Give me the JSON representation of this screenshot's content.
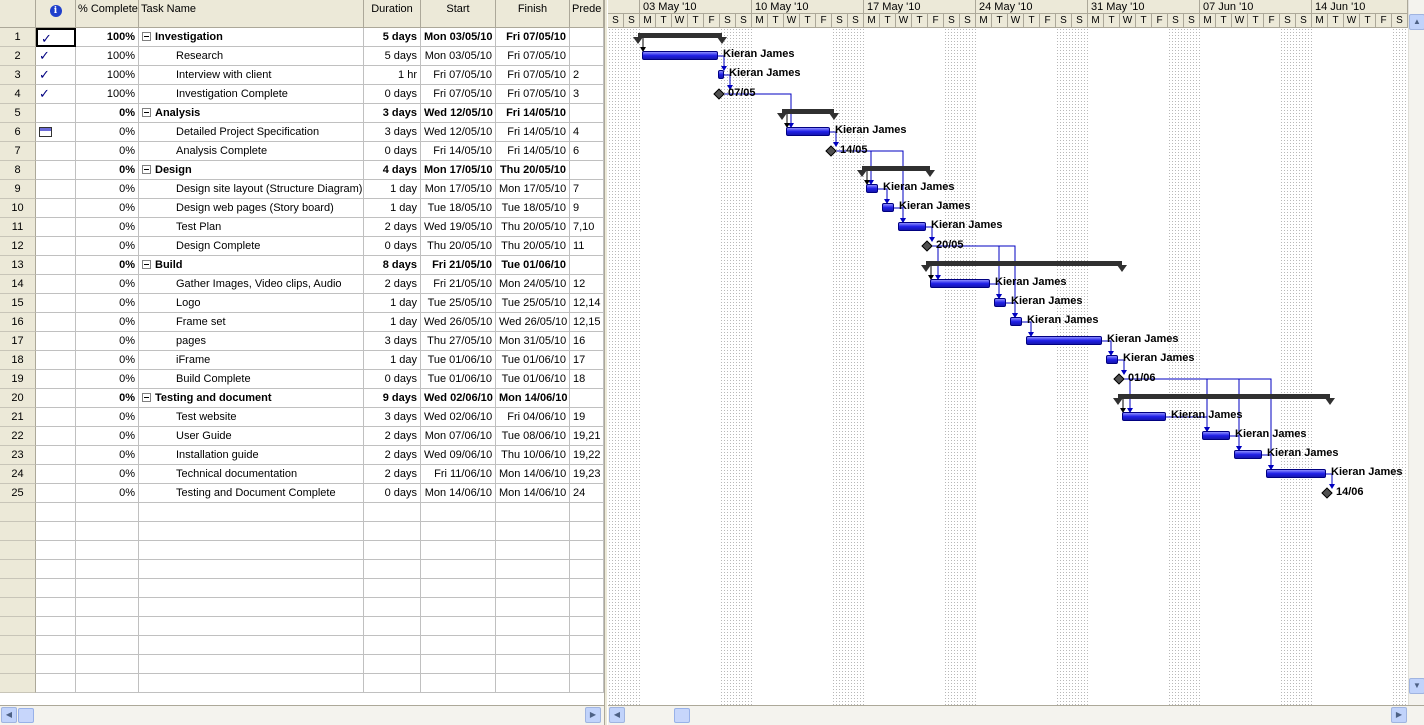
{
  "columns": {
    "indicator_icon": "info-icon",
    "percent": "% Complete",
    "name": "Task Name",
    "duration": "Duration",
    "start": "Start",
    "finish": "Finish",
    "pred": "Prede"
  },
  "tasks": [
    {
      "id": "1",
      "ind": "check",
      "pct": "100%",
      "name": "Investigation",
      "dur": "5 days",
      "start": "Mon 03/05/10",
      "finish": "Fri 07/05/10",
      "pred": "",
      "summary": true
    },
    {
      "id": "2",
      "ind": "check",
      "pct": "100%",
      "name": "Research",
      "dur": "5 days",
      "start": "Mon 03/05/10",
      "finish": "Fri 07/05/10",
      "pred": "",
      "summary": false
    },
    {
      "id": "3",
      "ind": "check",
      "pct": "100%",
      "name": "Interview with client",
      "dur": "1 hr",
      "start": "Fri 07/05/10",
      "finish": "Fri 07/05/10",
      "pred": "2",
      "summary": false
    },
    {
      "id": "4",
      "ind": "check",
      "pct": "100%",
      "name": "Investigation Complete",
      "dur": "0 days",
      "start": "Fri 07/05/10",
      "finish": "Fri 07/05/10",
      "pred": "3",
      "summary": false
    },
    {
      "id": "5",
      "ind": "",
      "pct": "0%",
      "name": "Analysis",
      "dur": "3 days",
      "start": "Wed 12/05/10",
      "finish": "Fri 14/05/10",
      "pred": "",
      "summary": true
    },
    {
      "id": "6",
      "ind": "table",
      "pct": "0%",
      "name": "Detailed Project Specification",
      "dur": "3 days",
      "start": "Wed 12/05/10",
      "finish": "Fri 14/05/10",
      "pred": "4",
      "summary": false
    },
    {
      "id": "7",
      "ind": "",
      "pct": "0%",
      "name": "Analysis Complete",
      "dur": "0 days",
      "start": "Fri 14/05/10",
      "finish": "Fri 14/05/10",
      "pred": "6",
      "summary": false
    },
    {
      "id": "8",
      "ind": "",
      "pct": "0%",
      "name": "Design",
      "dur": "4 days",
      "start": "Mon 17/05/10",
      "finish": "Thu 20/05/10",
      "pred": "",
      "summary": true
    },
    {
      "id": "9",
      "ind": "",
      "pct": "0%",
      "name": "Design site layout (Structure Diagram)",
      "dur": "1 day",
      "start": "Mon 17/05/10",
      "finish": "Mon 17/05/10",
      "pred": "7",
      "summary": false
    },
    {
      "id": "10",
      "ind": "",
      "pct": "0%",
      "name": "Design web pages (Story board)",
      "dur": "1 day",
      "start": "Tue 18/05/10",
      "finish": "Tue 18/05/10",
      "pred": "9",
      "summary": false
    },
    {
      "id": "11",
      "ind": "",
      "pct": "0%",
      "name": "Test Plan",
      "dur": "2 days",
      "start": "Wed 19/05/10",
      "finish": "Thu 20/05/10",
      "pred": "7,10",
      "summary": false
    },
    {
      "id": "12",
      "ind": "",
      "pct": "0%",
      "name": "Design Complete",
      "dur": "0 days",
      "start": "Thu 20/05/10",
      "finish": "Thu 20/05/10",
      "pred": "11",
      "summary": false
    },
    {
      "id": "13",
      "ind": "",
      "pct": "0%",
      "name": "Build",
      "dur": "8 days",
      "start": "Fri 21/05/10",
      "finish": "Tue 01/06/10",
      "pred": "",
      "summary": true
    },
    {
      "id": "14",
      "ind": "",
      "pct": "0%",
      "name": "Gather Images, Video clips, Audio",
      "dur": "2 days",
      "start": "Fri 21/05/10",
      "finish": "Mon 24/05/10",
      "pred": "12",
      "summary": false
    },
    {
      "id": "15",
      "ind": "",
      "pct": "0%",
      "name": "Logo",
      "dur": "1 day",
      "start": "Tue 25/05/10",
      "finish": "Tue 25/05/10",
      "pred": "12,14",
      "summary": false
    },
    {
      "id": "16",
      "ind": "",
      "pct": "0%",
      "name": "Frame set",
      "dur": "1 day",
      "start": "Wed 26/05/10",
      "finish": "Wed 26/05/10",
      "pred": "12,15",
      "summary": false
    },
    {
      "id": "17",
      "ind": "",
      "pct": "0%",
      "name": "pages",
      "dur": "3 days",
      "start": "Thu 27/05/10",
      "finish": "Mon 31/05/10",
      "pred": "16",
      "summary": false
    },
    {
      "id": "18",
      "ind": "",
      "pct": "0%",
      "name": "iFrame",
      "dur": "1 day",
      "start": "Tue 01/06/10",
      "finish": "Tue 01/06/10",
      "pred": "17",
      "summary": false
    },
    {
      "id": "19",
      "ind": "",
      "pct": "0%",
      "name": "Build Complete",
      "dur": "0 days",
      "start": "Tue 01/06/10",
      "finish": "Tue 01/06/10",
      "pred": "18",
      "summary": false
    },
    {
      "id": "20",
      "ind": "",
      "pct": "0%",
      "name": "Testing and document",
      "dur": "9 days",
      "start": "Wed 02/06/10",
      "finish": "Mon 14/06/10",
      "pred": "",
      "summary": true
    },
    {
      "id": "21",
      "ind": "",
      "pct": "0%",
      "name": "Test website",
      "dur": "3 days",
      "start": "Wed 02/06/10",
      "finish": "Fri 04/06/10",
      "pred": "19",
      "summary": false
    },
    {
      "id": "22",
      "ind": "",
      "pct": "0%",
      "name": "User Guide",
      "dur": "2 days",
      "start": "Mon 07/06/10",
      "finish": "Tue 08/06/10",
      "pred": "19,21",
      "summary": false
    },
    {
      "id": "23",
      "ind": "",
      "pct": "0%",
      "name": "Installation guide",
      "dur": "2 days",
      "start": "Wed 09/06/10",
      "finish": "Thu 10/06/10",
      "pred": "19,22",
      "summary": false
    },
    {
      "id": "24",
      "ind": "",
      "pct": "0%",
      "name": "Technical documentation",
      "dur": "2 days",
      "start": "Fri 11/06/10",
      "finish": "Mon 14/06/10",
      "pred": "19,23",
      "summary": false
    },
    {
      "id": "25",
      "ind": "",
      "pct": "0%",
      "name": "Testing and Document Complete",
      "dur": "0 days",
      "start": "Mon 14/06/10",
      "finish": "Mon 14/06/10",
      "pred": "24",
      "summary": false
    }
  ],
  "gantt": {
    "weeks": [
      "03 May '10",
      "10 May '10",
      "17 May '10",
      "24 May '10",
      "31 May '10",
      "07 Jun '10",
      "14 Jun '10"
    ],
    "day_letters": [
      "S",
      "M",
      "T",
      "W",
      "T",
      "F",
      "S"
    ],
    "resource": "Kieran James",
    "milestones": {
      "4": "07/05",
      "7": "14/05",
      "12": "20/05",
      "19": "01/06",
      "25": "14/06"
    },
    "bar_color": "#2020e8",
    "summary_color": "#303030"
  },
  "scroll": {
    "left_icon": "chevron-left-icon",
    "right_icon": "chevron-right-icon",
    "up_icon": "chevron-up-icon",
    "down_icon": "chevron-down-icon"
  }
}
